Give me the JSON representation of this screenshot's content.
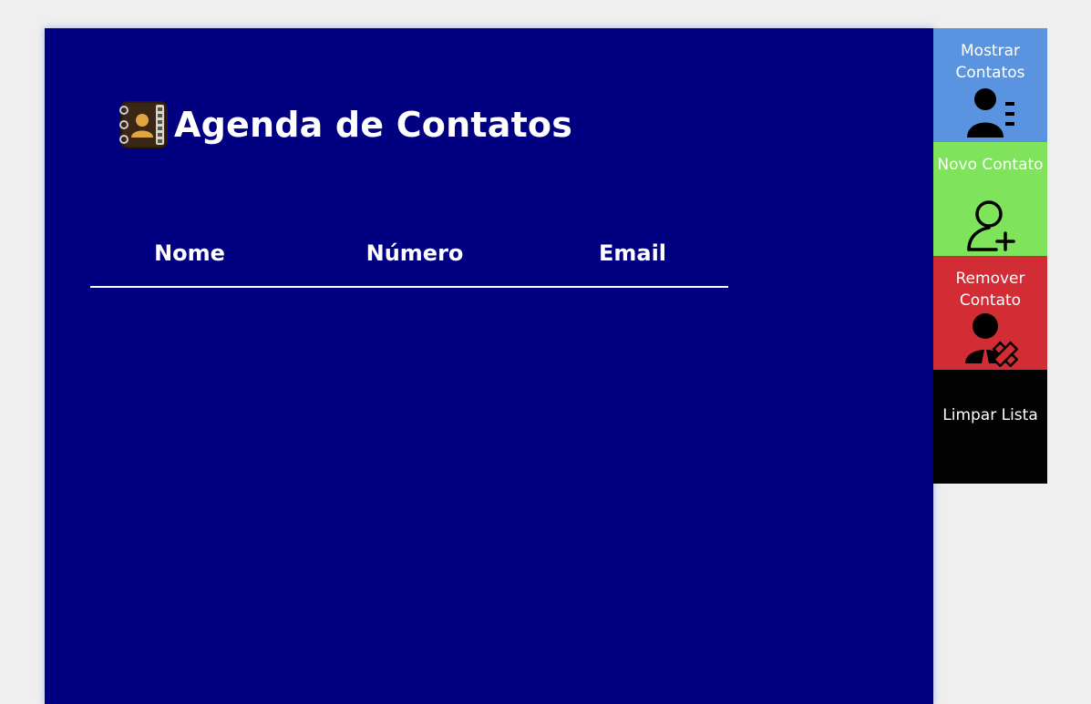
{
  "app": {
    "title": "Agenda de Contatos",
    "logo_icon": "contacts-book-icon"
  },
  "table": {
    "columns": [
      "Nome",
      "Número",
      "Email"
    ],
    "rows": []
  },
  "sidebar": {
    "buttons": [
      {
        "label": "Mostrar Contatos",
        "icon": "contact-list-icon",
        "color": "#5a94e0"
      },
      {
        "label": "Novo Contato",
        "icon": "add-user-icon",
        "color": "#7fe35b"
      },
      {
        "label": "Remover Contato",
        "icon": "remove-user-icon",
        "color": "#d22d35"
      },
      {
        "label": "Limpar Lista",
        "icon": "",
        "color": "#020202"
      }
    ]
  },
  "colors": {
    "page_background": "#efefef",
    "panel_background": "#000080",
    "text": "#ffffff"
  }
}
